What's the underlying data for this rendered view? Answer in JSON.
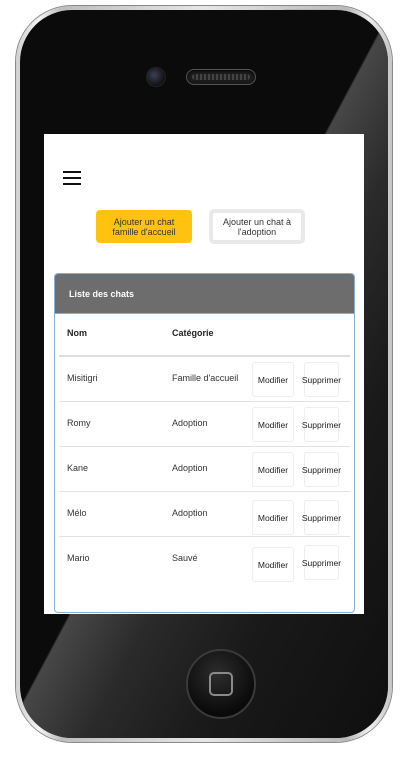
{
  "buttons": {
    "add_foster": "Ajouter un chat famille d'accueil",
    "add_adoption": "Ajouter un chat à l'adoption"
  },
  "card": {
    "title": "Liste des chats"
  },
  "table": {
    "headers": {
      "name": "Nom",
      "category": "Catégorie"
    },
    "rows": [
      {
        "name": "Misitigri",
        "category": "Famille d'accueil",
        "edit": "Modifier",
        "delete": "Supprimer"
      },
      {
        "name": "Romy",
        "category": "Adoption",
        "edit": "Modifier",
        "delete": "Supprimer"
      },
      {
        "name": "Kane",
        "category": "Adoption",
        "edit": "Modifier",
        "delete": "Supprimer"
      },
      {
        "name": "Mélo",
        "category": "Adoption",
        "edit": "Modifier",
        "delete": "Supprimer"
      },
      {
        "name": "Mario",
        "category": "Sauvé",
        "edit": "Modifier",
        "delete": "Supprimer"
      }
    ]
  },
  "colors": {
    "accent": "#ffc20e",
    "header_bg": "#6d6d6d",
    "card_border": "#8aaed0"
  },
  "icons": {
    "menu": "hamburger-menu-icon",
    "home": "home-button-icon",
    "camera": "camera-icon"
  }
}
